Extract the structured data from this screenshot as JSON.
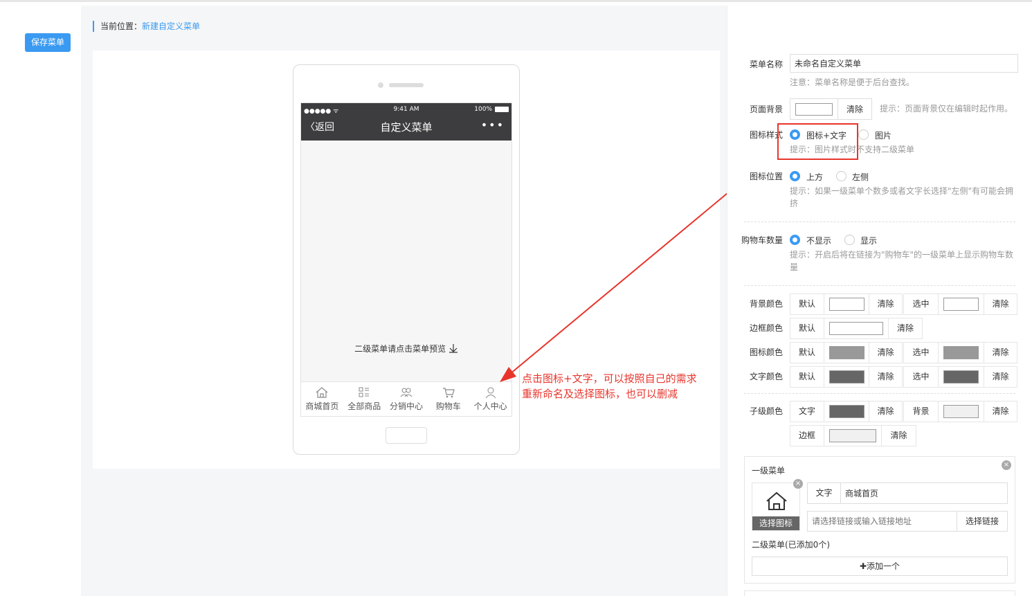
{
  "toolbar": {
    "save_label": "保存菜单"
  },
  "breadcrumb": {
    "prefix": "当前位置：",
    "current": "新建自定义菜单"
  },
  "phone": {
    "signal": "●●●●● ᯤ",
    "time": "9:41 AM",
    "battery": "100%",
    "back_label": "返回",
    "title": "自定义菜单",
    "more": "•••",
    "submenu_hint": "二级菜单请点击菜单预览",
    "tabs": [
      {
        "label": "商城首页",
        "icon": "home-icon"
      },
      {
        "label": "全部商品",
        "icon": "grid-list-icon"
      },
      {
        "label": "分销中心",
        "icon": "users-icon"
      },
      {
        "label": "购物车",
        "icon": "cart-icon"
      },
      {
        "label": "个人中心",
        "icon": "user-icon"
      }
    ]
  },
  "annotation": {
    "line1": "点击图标+文字，可以按照自己的需求",
    "line2": "重新命名及选择图标，也可以删减",
    "color": "#e8352c"
  },
  "settings": {
    "menu_name": {
      "label": "菜单名称",
      "value": "未命名自定义菜单",
      "tip": "注意：菜单名称是便于后台查找。"
    },
    "page_bg": {
      "label": "页面背景",
      "clear": "清除",
      "tip": "提示：页面背景仅在编辑时起作用。"
    },
    "icon_style": {
      "label": "图标样式",
      "option1": "图标+文字",
      "option2": "图片",
      "tip": "提示：图片样式时不支持二级菜单"
    },
    "icon_position": {
      "label": "图标位置",
      "option1": "上方",
      "option2": "左侧",
      "tip1": "提示：如果一级菜单个数多或者文字长选择\"左侧\"有可能会拥",
      "tip2": "挤"
    },
    "cart_count": {
      "label": "购物车数量",
      "option1": "不显示",
      "option2": "显示",
      "tip1": "提示：开启后将在链接为\"购物车\"的一级菜单上显示购物车数",
      "tip2": "量"
    },
    "bg_color": {
      "label": "背景颜色",
      "default": "默认",
      "clear": "清除",
      "selected": "选中"
    },
    "border_color": {
      "label": "边框颜色",
      "default": "默认",
      "clear": "清除"
    },
    "icon_color": {
      "label": "图标颜色",
      "default": "默认",
      "clear": "清除",
      "selected": "选中"
    },
    "text_color": {
      "label": "文字颜色",
      "default": "默认",
      "clear": "清除",
      "selected": "选中"
    },
    "child_color": {
      "label": "子级颜色",
      "text": "文字",
      "clear": "清除",
      "bg": "背景",
      "border": "边框"
    }
  },
  "menu_card": {
    "title": "一级菜单",
    "text_label": "文字",
    "text_value": "商城首页",
    "choose_icon": "选择图标",
    "link_placeholder": "请选择链接或输入链接地址",
    "choose_link": "选择链接",
    "submenu_count": "二级菜单(已添加0个)",
    "add_one": "添加一个",
    "close": "×"
  },
  "colors": {
    "accent": "#3a9af2",
    "annotation_red": "#e8352c",
    "swatch_gray_light": "#999999",
    "swatch_gray_dark": "#666666",
    "swatch_white": "#ffffff",
    "swatch_offwhite": "#f0f0f0"
  }
}
